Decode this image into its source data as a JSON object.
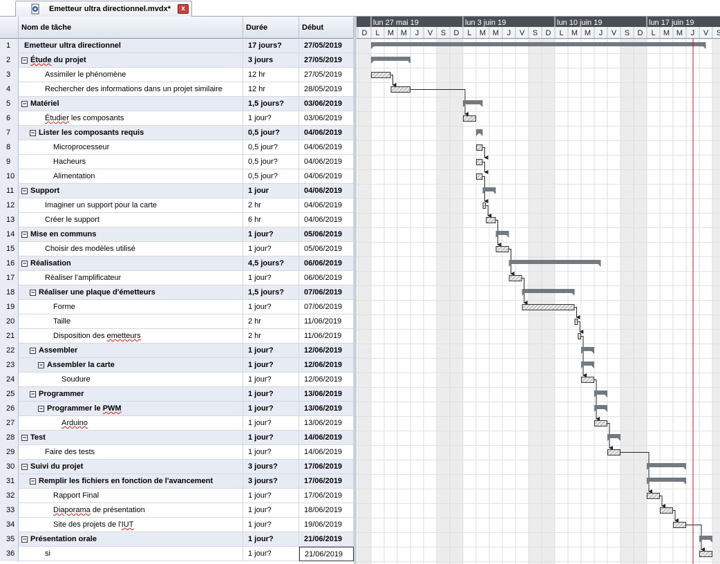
{
  "tab": {
    "title": "Emetteur ultra directionnel.mvdx*",
    "icon": "document-icon",
    "close_label": "x"
  },
  "columns": {
    "id": "",
    "name": "Nom de tâche",
    "duration": "Durée",
    "start": "Début"
  },
  "tasks": [
    {
      "id": "1",
      "name": "Emetteur ultra directionnel",
      "duration": "17 jours?",
      "start": "27/05/2019",
      "summary": true,
      "level": 0,
      "toggle": false
    },
    {
      "id": "2",
      "name": "Étude du projet",
      "duration": "3 jours",
      "start": "27/05/2019",
      "summary": true,
      "level": 0,
      "toggle": true
    },
    {
      "id": "3",
      "name": "Assimiler le phénomène",
      "duration": "12 hr",
      "start": "27/05/2019",
      "summary": false,
      "level": 1,
      "toggle": false
    },
    {
      "id": "4",
      "name": "Rechercher des informations dans un projet similaire",
      "duration": "12 hr",
      "start": "28/05/2019",
      "summary": false,
      "level": 1,
      "toggle": false
    },
    {
      "id": "5",
      "name": "Matériel",
      "duration": "1,5 jours?",
      "start": "03/06/2019",
      "summary": true,
      "level": 0,
      "toggle": true
    },
    {
      "id": "6",
      "name": "Étudier les composants",
      "duration": "1 jour?",
      "start": "03/06/2019",
      "summary": false,
      "level": 1,
      "toggle": false
    },
    {
      "id": "7",
      "name": "Lister les composants requis",
      "duration": "0,5 jour?",
      "start": "04/06/2019",
      "summary": true,
      "level": 1,
      "toggle": true
    },
    {
      "id": "8",
      "name": "Microprocesseur",
      "duration": "0,5 jour?",
      "start": "04/06/2019",
      "summary": false,
      "level": 2,
      "toggle": false
    },
    {
      "id": "9",
      "name": "Hacheurs",
      "duration": "0,5 jour?",
      "start": "04/06/2019",
      "summary": false,
      "level": 2,
      "toggle": false
    },
    {
      "id": "10",
      "name": "Alimentation",
      "duration": "0,5 jour?",
      "start": "04/06/2019",
      "summary": false,
      "level": 2,
      "toggle": false
    },
    {
      "id": "11",
      "name": "Support",
      "duration": "1 jour",
      "start": "04/06/2019",
      "summary": true,
      "level": 0,
      "toggle": true
    },
    {
      "id": "12",
      "name": "Imaginer un support pour la carte",
      "duration": "2 hr",
      "start": "04/06/2019",
      "summary": false,
      "level": 1,
      "toggle": false
    },
    {
      "id": "13",
      "name": "Créer le support",
      "duration": "6 hr",
      "start": "04/06/2019",
      "summary": false,
      "level": 1,
      "toggle": false
    },
    {
      "id": "14",
      "name": "Mise en communs",
      "duration": "1 jour?",
      "start": "05/06/2019",
      "summary": true,
      "level": 0,
      "toggle": true
    },
    {
      "id": "15",
      "name": "Choisir des modèles utilisé",
      "duration": "1 jour?",
      "start": "05/06/2019",
      "summary": false,
      "level": 1,
      "toggle": false
    },
    {
      "id": "16",
      "name": "Réalisation",
      "duration": "4,5 jours?",
      "start": "06/06/2019",
      "summary": true,
      "level": 0,
      "toggle": true
    },
    {
      "id": "17",
      "name": "Réaliser l'amplificateur",
      "duration": "1 jour?",
      "start": "06/06/2019",
      "summary": false,
      "level": 1,
      "toggle": false
    },
    {
      "id": "18",
      "name": "Réaliser une plaque d'émetteurs",
      "duration": "1,5 jours?",
      "start": "07/06/2019",
      "summary": true,
      "level": 1,
      "toggle": true
    },
    {
      "id": "19",
      "name": "Forme",
      "duration": "1 jour?",
      "start": "07/06/2019",
      "summary": false,
      "level": 2,
      "toggle": false
    },
    {
      "id": "20",
      "name": "Taille",
      "duration": "2 hr",
      "start": "11/06/2019",
      "summary": false,
      "level": 2,
      "toggle": false
    },
    {
      "id": "21",
      "name": "Disposition des emetteurs",
      "duration": "2 hr",
      "start": "11/06/2019",
      "summary": false,
      "level": 2,
      "toggle": false
    },
    {
      "id": "22",
      "name": "Assembler",
      "duration": "1 jour?",
      "start": "12/06/2019",
      "summary": true,
      "level": 1,
      "toggle": true
    },
    {
      "id": "23",
      "name": "Assembler la carte",
      "duration": "1 jour?",
      "start": "12/06/2019",
      "summary": true,
      "level": 2,
      "toggle": true
    },
    {
      "id": "24",
      "name": "Soudure",
      "duration": "1 jour?",
      "start": "12/06/2019",
      "summary": false,
      "level": 3,
      "toggle": false
    },
    {
      "id": "25",
      "name": "Programmer",
      "duration": "1 jour?",
      "start": "13/06/2019",
      "summary": true,
      "level": 1,
      "toggle": true
    },
    {
      "id": "26",
      "name": "Programmer le PWM",
      "duration": "1 jour?",
      "start": "13/06/2019",
      "summary": true,
      "level": 2,
      "toggle": true
    },
    {
      "id": "27",
      "name": "Arduino",
      "duration": "1 jour?",
      "start": "13/06/2019",
      "summary": false,
      "level": 3,
      "toggle": false
    },
    {
      "id": "28",
      "name": "Test",
      "duration": "1 jour?",
      "start": "14/06/2019",
      "summary": true,
      "level": 0,
      "toggle": true
    },
    {
      "id": "29",
      "name": "Faire des tests",
      "duration": "1 jour?",
      "start": "14/06/2019",
      "summary": false,
      "level": 1,
      "toggle": false
    },
    {
      "id": "30",
      "name": "Suivi du projet",
      "duration": "3 jours?",
      "start": "17/06/2019",
      "summary": true,
      "level": 0,
      "toggle": true
    },
    {
      "id": "31",
      "name": "Remplir les fichiers en fonction de l'avancement",
      "duration": "3 jours?",
      "start": "17/06/2019",
      "summary": true,
      "level": 1,
      "toggle": true
    },
    {
      "id": "32",
      "name": "Rapport Final",
      "duration": "1 jour?",
      "start": "17/06/2019",
      "summary": false,
      "level": 2,
      "toggle": false
    },
    {
      "id": "33",
      "name": "Diaporama de présentation",
      "duration": "1 jour?",
      "start": "18/06/2019",
      "summary": false,
      "level": 2,
      "toggle": false
    },
    {
      "id": "34",
      "name": "Site des projets de l'IUT",
      "duration": "1 jour?",
      "start": "19/06/2019",
      "summary": false,
      "level": 2,
      "toggle": false
    },
    {
      "id": "35",
      "name": "Présentation orale",
      "duration": "1 jour?",
      "start": "21/06/2019",
      "summary": true,
      "level": 0,
      "toggle": true
    },
    {
      "id": "36",
      "name": "si",
      "duration": "1 jour?",
      "start": "21/06/2019",
      "summary": false,
      "level": 1,
      "toggle": false,
      "selected": true
    }
  ],
  "timeline": {
    "weeks": [
      "lun 27 mai 19",
      "lun 3 juin 19",
      "lun 10 juin 19",
      "lun 17 juin 19"
    ],
    "day_letters": [
      "D",
      "L",
      "M",
      "M",
      "J",
      "V",
      "S",
      "D",
      "L",
      "M",
      "M",
      "J",
      "V",
      "S",
      "D",
      "L",
      "M",
      "M",
      "J",
      "V",
      "S",
      "D",
      "L",
      "M",
      "M",
      "J",
      "V",
      "S"
    ],
    "today_day_index": 25.5,
    "colors": {
      "summary": "#707a80",
      "task_fill": "#e8e8e8",
      "task_stroke": "#333333",
      "weekend": "#ececec",
      "today": "#c8141e",
      "header": "#4a4f55"
    }
  },
  "bars": [
    {
      "row": 0,
      "start": 1.0,
      "end": 26.5,
      "summary": true
    },
    {
      "row": 1,
      "start": 1.0,
      "end": 4.0,
      "summary": true
    },
    {
      "row": 2,
      "start": 1.0,
      "end": 2.5
    },
    {
      "row": 3,
      "start": 2.5,
      "end": 4.0
    },
    {
      "row": 4,
      "start": 8.0,
      "end": 9.5,
      "summary": true
    },
    {
      "row": 5,
      "start": 8.0,
      "end": 9.0
    },
    {
      "row": 6,
      "start": 9.0,
      "end": 9.5,
      "summary": true
    },
    {
      "row": 7,
      "start": 9.0,
      "end": 9.5
    },
    {
      "row": 8,
      "start": 9.0,
      "end": 9.5
    },
    {
      "row": 9,
      "start": 9.0,
      "end": 9.5
    },
    {
      "row": 10,
      "start": 9.5,
      "end": 10.5,
      "summary": true
    },
    {
      "row": 11,
      "start": 9.5,
      "end": 9.75
    },
    {
      "row": 12,
      "start": 9.75,
      "end": 10.5
    },
    {
      "row": 13,
      "start": 10.5,
      "end": 11.5,
      "summary": true
    },
    {
      "row": 14,
      "start": 10.5,
      "end": 11.5
    },
    {
      "row": 15,
      "start": 11.5,
      "end": 18.5,
      "summary": true
    },
    {
      "row": 16,
      "start": 11.5,
      "end": 12.5
    },
    {
      "row": 17,
      "start": 12.5,
      "end": 16.5,
      "summary": true
    },
    {
      "row": 18,
      "start": 12.5,
      "end": 16.5
    },
    {
      "row": 19,
      "start": 16.5,
      "end": 16.75
    },
    {
      "row": 20,
      "start": 16.75,
      "end": 17.0
    },
    {
      "row": 21,
      "start": 17.0,
      "end": 18.0,
      "summary": true
    },
    {
      "row": 22,
      "start": 17.0,
      "end": 18.0,
      "summary": true
    },
    {
      "row": 23,
      "start": 17.0,
      "end": 18.0
    },
    {
      "row": 24,
      "start": 18.0,
      "end": 19.0,
      "summary": true
    },
    {
      "row": 25,
      "start": 18.0,
      "end": 19.0,
      "summary": true
    },
    {
      "row": 26,
      "start": 18.0,
      "end": 19.0
    },
    {
      "row": 27,
      "start": 19.0,
      "end": 20.0,
      "summary": true
    },
    {
      "row": 28,
      "start": 19.0,
      "end": 20.0
    },
    {
      "row": 29,
      "start": 22.0,
      "end": 25.0,
      "summary": true
    },
    {
      "row": 30,
      "start": 22.0,
      "end": 25.0,
      "summary": true
    },
    {
      "row": 31,
      "start": 22.0,
      "end": 23.0
    },
    {
      "row": 32,
      "start": 23.0,
      "end": 24.0
    },
    {
      "row": 33,
      "start": 24.0,
      "end": 25.0
    },
    {
      "row": 34,
      "start": 26.0,
      "end": 27.0,
      "summary": true
    },
    {
      "row": 35,
      "start": 26.0,
      "end": 27.0
    }
  ],
  "links": [
    [
      2,
      3
    ],
    [
      3,
      5
    ],
    [
      7,
      8
    ],
    [
      8,
      9
    ],
    [
      9,
      11
    ],
    [
      11,
      12
    ],
    [
      12,
      14
    ],
    [
      14,
      16
    ],
    [
      16,
      18
    ],
    [
      18,
      19
    ],
    [
      19,
      20
    ],
    [
      20,
      23
    ],
    [
      23,
      26
    ],
    [
      26,
      28
    ],
    [
      28,
      31
    ],
    [
      31,
      32
    ],
    [
      32,
      33
    ],
    [
      33,
      35
    ]
  ]
}
